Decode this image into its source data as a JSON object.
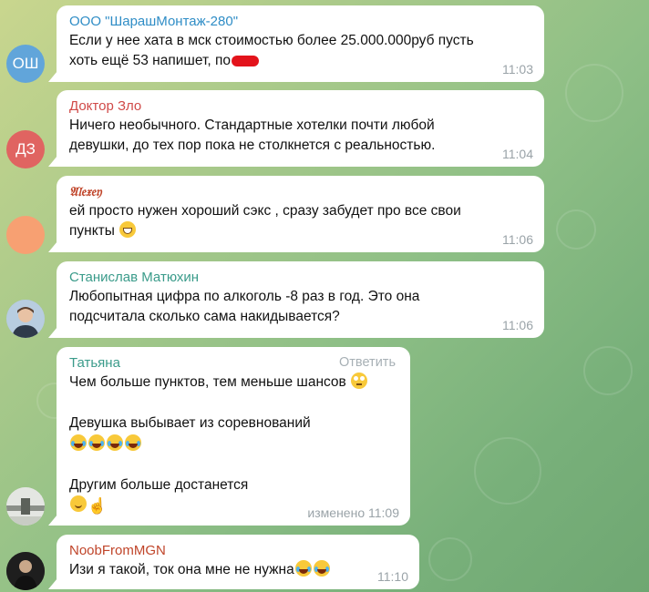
{
  "messages": [
    {
      "sender": "ООО \"ШарашМонтаж-280\"",
      "sender_color": "#2f8dc6",
      "avatar_initials": "ОШ",
      "avatar_color": "#61a5da",
      "lines": [
        "Если у нее хата в мск стоимостью более 25.000.000руб пусть",
        "хоть ещё 53 напишет, по"
      ],
      "time": "11:03"
    },
    {
      "sender": "Доктор Зло",
      "sender_color": "#d04a48",
      "avatar_initials": "ДЗ",
      "avatar_color": "#e06461",
      "lines": [
        "Ничего необычного. Стандартные хотелки почти любой",
        "девушки, до тех пор пока не столкнется с реальностью."
      ],
      "time": "11:04"
    },
    {
      "sender": "𝔄𝔩𝔢𝔵𝔢𝔶",
      "sender_color": "#c0452a",
      "avatar_initials": "",
      "avatar_color": "#f7a072",
      "lines": [
        "ей просто нужен хороший сэкс , сразу забудет про все свои",
        "пункты"
      ],
      "time": "11:06"
    },
    {
      "sender": "Станислав Матюхин",
      "sender_color": "#3a9b8a",
      "avatar_initials": "",
      "avatar_color": "#9ab5cf",
      "lines": [
        "Любопытная цифра по алкоголь -8 раз в год. Это она",
        "подсчитала сколько сама накидывается?"
      ],
      "time": "11:06"
    },
    {
      "sender": "Татьяна",
      "sender_color": "#3a9b8a",
      "reply_label": "Ответить",
      "avatar_color": "#d9dcdc",
      "lines": [
        "Чем больше пунктов, тем меньше шансов",
        "",
        "Девушка выбывает из соревнований",
        "",
        "",
        "Другим больше достанется",
        ""
      ],
      "time": "изменено 11:09"
    },
    {
      "sender": "NoobFromMGN",
      "sender_color": "#c0452a",
      "avatar_color": "#3a3a3a",
      "lines": [
        "Изи я такой, ток она мне не нужна"
      ],
      "time": "11:10"
    }
  ]
}
